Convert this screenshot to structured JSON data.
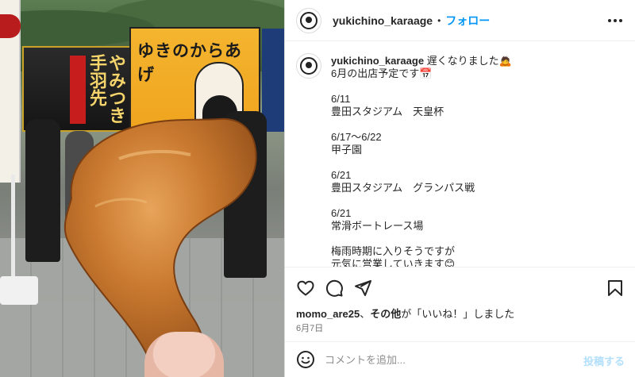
{
  "post": {
    "username": "yukichino_karaage",
    "separator": "•",
    "follow_label": "フォロー"
  },
  "photo": {
    "banner_center_text": "ゆきのからあげ",
    "banner_left_text": "やみつき手羽先"
  },
  "caption": {
    "username": "yukichino_karaage",
    "lines": [
      " 遅くなりました🙇",
      "6月の出店予定です📅",
      "",
      "6/11",
      "豊田スタジアム　天皇杯",
      "",
      "6/17〜6/22",
      "甲子園",
      "",
      "6/21",
      "豊田スタジアム　グランパス戦",
      "",
      "6/21",
      "常滑ボートレース場",
      "",
      "梅雨時期に入りそうですが",
      "元気に営業していきます😊"
    ]
  },
  "likes": {
    "user": "momo_are25",
    "separator": "、",
    "others": "その他",
    "suffix": "が「いいね！」しました"
  },
  "date": "6月7日",
  "comment": {
    "placeholder": "コメントを追加...",
    "post_label": "投稿する"
  },
  "colors": {
    "accent": "#0095f6",
    "post_disabled": "#b2dffc",
    "text": "#262626",
    "muted": "#737373"
  },
  "icons": {
    "more": "more-horizontal-icon",
    "like": "heart-icon",
    "comment": "comment-icon",
    "share": "paper-plane-icon",
    "save": "bookmark-icon",
    "emoji": "smiley-icon"
  }
}
